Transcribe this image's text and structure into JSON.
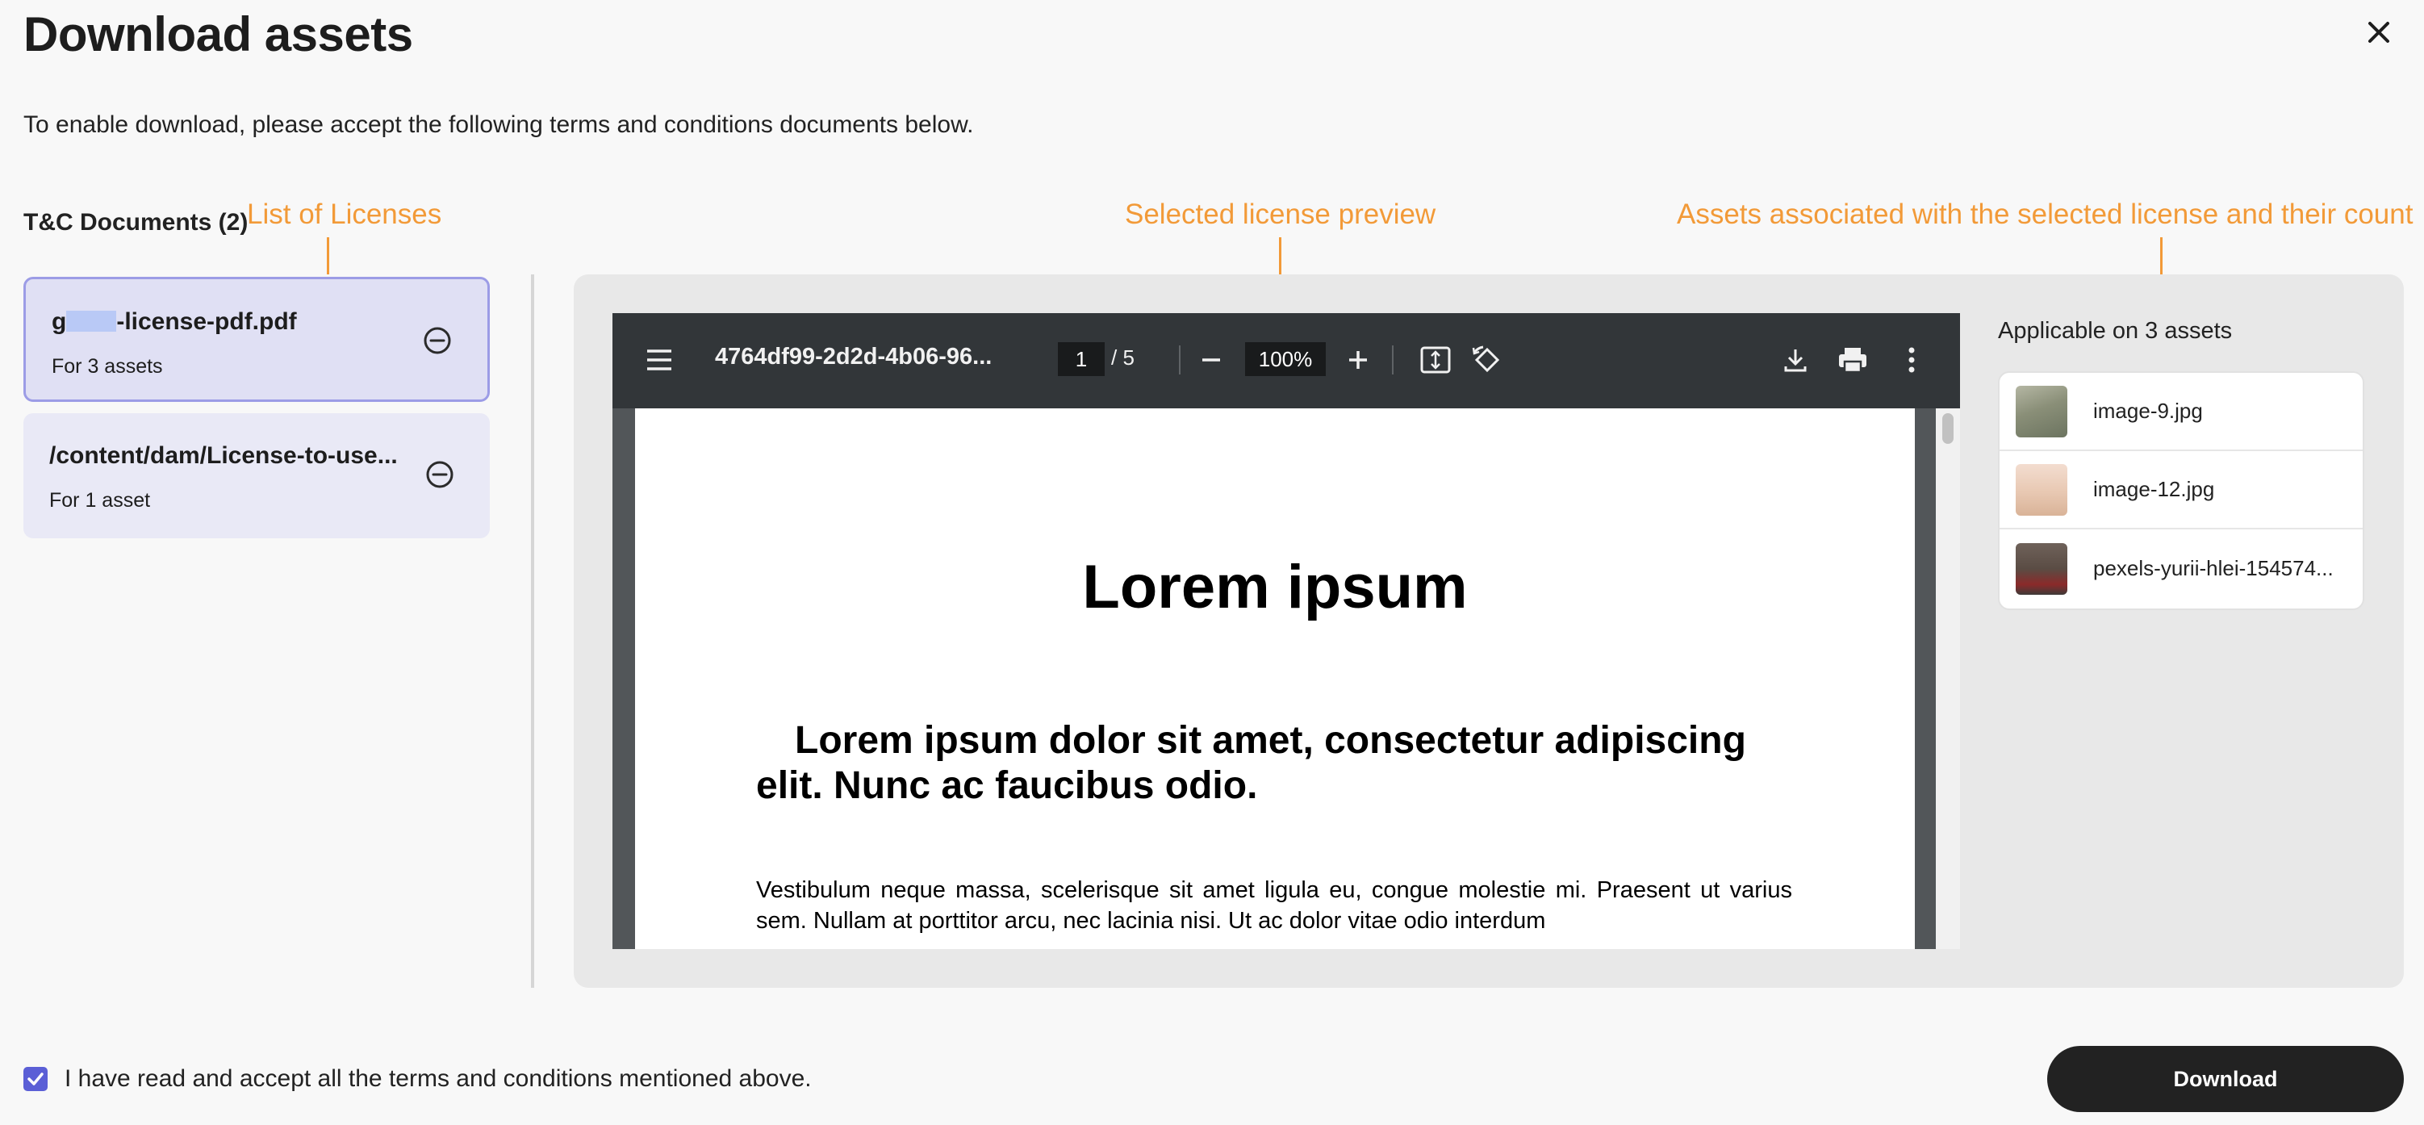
{
  "header": {
    "title": "Download assets",
    "subtitle": "To enable download, please accept the following terms and conditions documents below."
  },
  "annotations": {
    "licenses": "List of Licenses",
    "preview": "Selected license preview",
    "assets": "Assets associated with the selected license and their count"
  },
  "documents": {
    "heading": "T&C Documents (2)",
    "items": [
      {
        "title_prefix": "g",
        "title_suffix": "-license-pdf.pdf",
        "subtitle": "For 3 assets",
        "selected": true
      },
      {
        "title": "/content/dam/License-to-use...",
        "subtitle": "For 1 asset",
        "selected": false
      }
    ]
  },
  "viewer": {
    "filename": "4764df99-2d2d-4b06-96...",
    "current_page": "1",
    "total_pages": "/  5",
    "zoom": "100%",
    "icons": [
      "menu-icon",
      "zoom-out-icon",
      "zoom-in-icon",
      "fit-page-icon",
      "rotate-icon",
      "download-icon",
      "print-icon",
      "more-vert-icon"
    ],
    "page": {
      "heading": "Lorem ipsum",
      "subheading": "Lorem ipsum dolor sit amet, consectetur adipiscing elit. Nunc ac faucibus odio.",
      "paragraph": "Vestibulum neque massa, scelerisque sit amet ligula eu, congue molestie mi. Praesent ut varius sem. Nullam at porttitor arcu, nec lacinia nisi. Ut ac dolor vitae odio interdum"
    }
  },
  "assets": {
    "heading": "Applicable on 3 assets",
    "items": [
      {
        "name": "image-9.jpg",
        "thumb_color": "#8a8f78"
      },
      {
        "name": "image-12.jpg",
        "thumb_color": "#e8c8b2"
      },
      {
        "name": "pexels-yurii-hlei-154574...",
        "thumb_color": "#5a4c44"
      }
    ]
  },
  "footer": {
    "accept_label": "I have read and accept all the terms and conditions mentioned above.",
    "accept_checked": true,
    "download_label": "Download"
  },
  "colors": {
    "accent": "#5b5fd6",
    "annotation": "#f29a38",
    "selected_card_border": "#9c9ce6",
    "viewer_toolbar": "#323639"
  }
}
